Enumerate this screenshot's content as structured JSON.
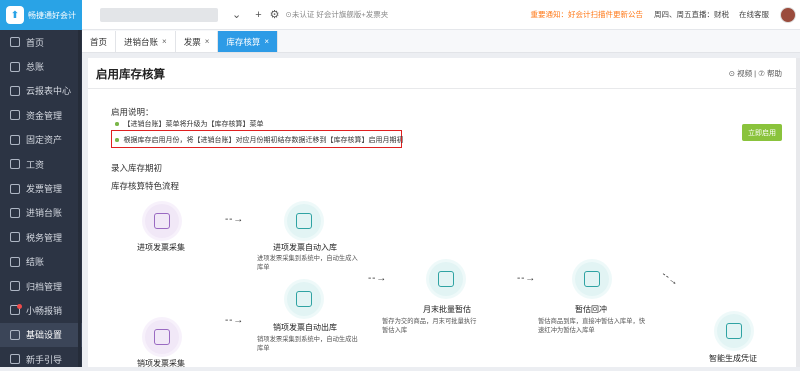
{
  "app": {
    "logo_text": "畅捷通好会计"
  },
  "sidebar": {
    "items": [
      {
        "label": "首页"
      },
      {
        "label": "总账"
      },
      {
        "label": "云报表中心"
      },
      {
        "label": "资金管理"
      },
      {
        "label": "固定资产"
      },
      {
        "label": "工资"
      },
      {
        "label": "发票管理"
      },
      {
        "label": "进销台账"
      },
      {
        "label": "税务管理"
      },
      {
        "label": "结账"
      },
      {
        "label": "归档管理"
      },
      {
        "label": "小畅报销"
      },
      {
        "label": "基础设置"
      },
      {
        "label": "新手引导"
      }
    ]
  },
  "topbar": {
    "chevron": "⌄",
    "plus": "+",
    "gear": "⚙",
    "tag": "⊙未认证  好会计旗舰版+发票夹",
    "notice": "重要通知：好会计扫描件更新公告",
    "live": "周四、周五直播：财税",
    "service": "在线客服"
  },
  "tabs": [
    {
      "label": "首页",
      "closable": false
    },
    {
      "label": "进销台账",
      "closable": true
    },
    {
      "label": "发票",
      "closable": true
    },
    {
      "label": "库存核算",
      "closable": true
    }
  ],
  "content": {
    "title": "启用库存核算",
    "help": "⊙ 视频  |  ⑦ 帮助",
    "instructions_title": "启用说明：",
    "note1": "【进销台账】菜单将升级为【库存核算】菜单",
    "note2": "根据库存启用月份，将【进销台账】对应月份期初结存数据迁移到【库存核算】启用月期初",
    "enable_button": "立即启用",
    "section1": "录入库存期初",
    "section2": "库存核算特色流程",
    "nodes": {
      "in_collect": "进项发票采集",
      "in_auto": "进项发票自动入库",
      "in_auto_desc": "进项发票采集到系统中，自动生成入库单",
      "out_auto": "销项发票自动出库",
      "out_auto_desc": "销项发票采集到系统中，自动生成出库单",
      "out_collect": "销项发票采集",
      "estimate": "月末批量暂估",
      "estimate_desc": "暂存为交的商品，月末可批量执行暂估入库",
      "reverse": "暂估回冲",
      "reverse_desc": "暂估商品到库，直接冲暂估入库单，快速红冲为暂估入库单",
      "voucher": "智能生成凭证"
    },
    "arrow": "- - →"
  },
  "colors": {
    "sidebar_bg": "#2c3444",
    "accent": "#2d9be6",
    "enable_btn": "#8ac33c",
    "alert": "#e02020"
  }
}
